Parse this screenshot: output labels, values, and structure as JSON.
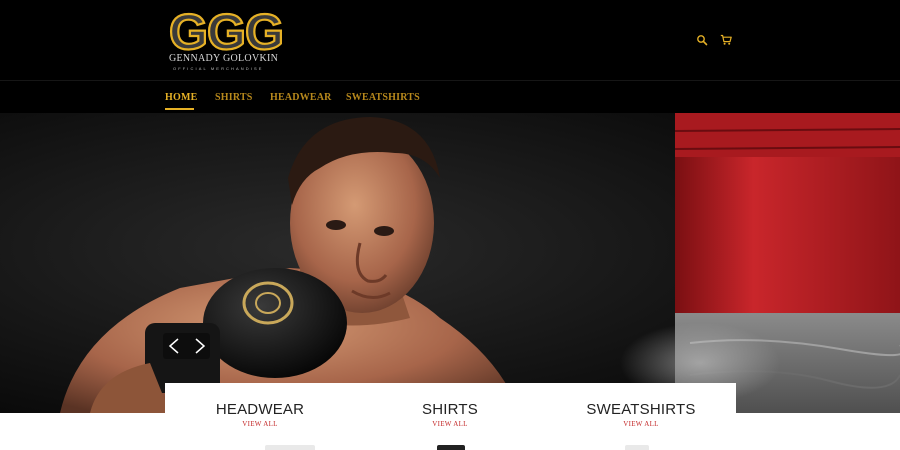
{
  "brand": {
    "mark": "GGG",
    "name": "GENNADY GOLOVKIN",
    "tagline": "OFFICIAL MERCHANDISE",
    "gold": "#e6b126"
  },
  "header_icons": [
    "search-icon",
    "cart-icon"
  ],
  "nav": [
    {
      "label": "HOME",
      "active": true
    },
    {
      "label": "SHIRTS",
      "active": false
    },
    {
      "label": "HEADWEAR",
      "active": false
    },
    {
      "label": "SWEATSHIRTS",
      "active": false
    }
  ],
  "hero": {
    "slide_indicator_icon": "chevron-left-icon"
  },
  "collections": [
    {
      "title": "HEADWEAR",
      "link": "VIEW ALL"
    },
    {
      "title": "SHIRTS",
      "link": "VIEW ALL"
    },
    {
      "title": "SWEATSHIRTS",
      "link": "VIEW ALL"
    }
  ],
  "colors": {
    "header_bg": "#000000",
    "nav_text": "#b8891c",
    "link_red": "#c42a2a"
  }
}
